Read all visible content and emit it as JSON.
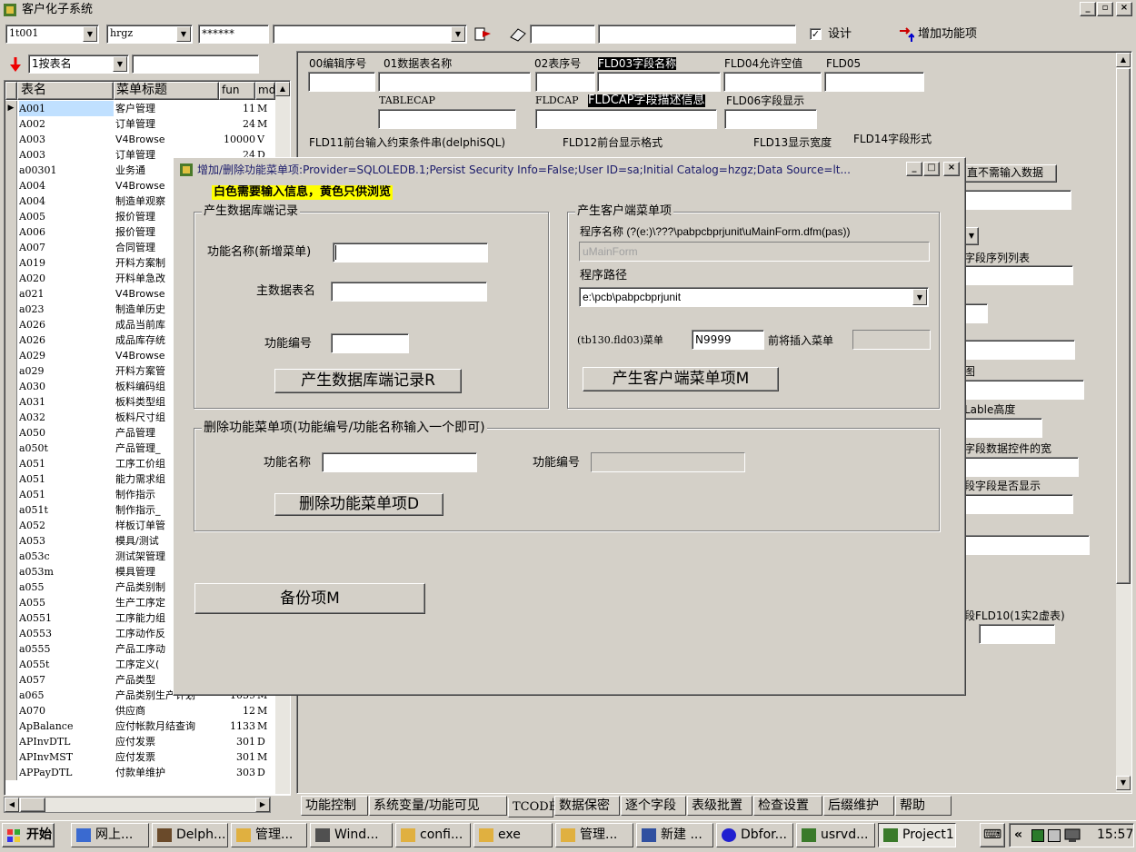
{
  "app": {
    "title": "客户化子系统"
  },
  "toolbar": {
    "combo1": "1t001",
    "combo2": "hrgz",
    "password": "******",
    "combo3": "",
    "field1": "",
    "field2": "",
    "check_label": "设计",
    "add_label": "增加功能项"
  },
  "left": {
    "sort_combo": "1按表名",
    "search": "",
    "headers": [
      "表名",
      "菜单标题",
      "fun",
      "md"
    ],
    "rows": [
      [
        "A001",
        "客户管理",
        "11",
        "M"
      ],
      [
        "A002",
        "订单管理",
        "24",
        "M"
      ],
      [
        "A003",
        "V4Browse",
        "10000",
        "V"
      ],
      [
        "A003",
        "订单管理",
        "24",
        "D"
      ],
      [
        "a00301",
        "业务通",
        "",
        ""
      ],
      [
        "A004",
        "V4Browse",
        "",
        ""
      ],
      [
        "A004",
        "制造单观察",
        "",
        ""
      ],
      [
        "A005",
        "报价管理",
        "",
        ""
      ],
      [
        "A006",
        "报价管理",
        "",
        ""
      ],
      [
        "A007",
        "合同管理",
        "",
        ""
      ],
      [
        "A019",
        "开料方案制",
        "",
        ""
      ],
      [
        "A020",
        "开料单急改",
        "",
        ""
      ],
      [
        "a021",
        "V4Browse",
        "",
        ""
      ],
      [
        "a023",
        "制造单历史",
        "",
        ""
      ],
      [
        "A026",
        "成品当前库",
        "",
        ""
      ],
      [
        "A026",
        "成品库存统",
        "",
        ""
      ],
      [
        "A029",
        "V4Browse",
        "",
        ""
      ],
      [
        "a029",
        "开料方案管",
        "",
        ""
      ],
      [
        "A030",
        "板料编码组",
        "",
        ""
      ],
      [
        "A031",
        "板料类型组",
        "",
        ""
      ],
      [
        "A032",
        "板料尺寸组",
        "",
        ""
      ],
      [
        "A050",
        "产品管理",
        "",
        ""
      ],
      [
        "a050t",
        "产品管理_",
        "",
        ""
      ],
      [
        "A051",
        "工序工价组",
        "",
        ""
      ],
      [
        "A051",
        "能力需求组",
        "",
        ""
      ],
      [
        "A051",
        "制作指示",
        "",
        ""
      ],
      [
        "a051t",
        "制作指示_",
        "",
        ""
      ],
      [
        "A052",
        "样板订单管",
        "",
        ""
      ],
      [
        "A053",
        "模具/测试",
        "",
        ""
      ],
      [
        "a053c",
        "测试架管理",
        "",
        ""
      ],
      [
        "a053m",
        "模具管理",
        "",
        ""
      ],
      [
        "a055",
        "产品类别制",
        "",
        ""
      ],
      [
        "A055",
        "生产工序定",
        "",
        ""
      ],
      [
        "A0551",
        "工序能力组",
        "",
        ""
      ],
      [
        "A0553",
        "工序动作反",
        "",
        ""
      ],
      [
        "a0555",
        "产品工序动",
        "",
        ""
      ],
      [
        "A055t",
        "工序定义(",
        "",
        ""
      ],
      [
        "A057",
        "产品类型",
        "",
        ""
      ],
      [
        "a065",
        "产品类别生产计划",
        "1059",
        "M"
      ],
      [
        "A070",
        "供应商",
        "12",
        "M"
      ],
      [
        "ApBalance",
        "应付帐款月结查询",
        "1133",
        "M"
      ],
      [
        "APInvDTL",
        "应付发票",
        "301",
        "D"
      ],
      [
        "APInvMST",
        "应付发票",
        "301",
        "M"
      ],
      [
        "APPayDTL",
        "付款单维护",
        "303",
        "D"
      ]
    ]
  },
  "right": {
    "f00": "00编辑序号",
    "f01": "01数据表名称",
    "f02": "02表序号",
    "f03": "FLD03字段名称",
    "f04": "FLD04允许空值",
    "f05": "FLD05",
    "tablecap": "TABLECAP",
    "fldcap": "FLDCAP",
    "fldcap2": "FLDCAP字段描述信息",
    "f06": "FLD06字段显示",
    "f11": "FLD11前台输入约束条件串(delphiSQL)",
    "f12": "FLD12前台显示格式",
    "f13": "FLD13显示宽度",
    "f14": "FLD14字段形式",
    "no_input": "直不需输入数据",
    "seq_list": "字段序列列表",
    "pic": "图",
    "lable_h": "Lable高度",
    "ctrl_w": "字段数据控件的宽",
    "show": "段字段是否显示",
    "fld10": "段FLD10(1实2虚表)"
  },
  "dialog": {
    "title": "增加/删除功能菜单项:Provider=SQLOLEDB.1;Persist Security Info=False;User ID=sa;Initial Catalog=hzgz;Data Source=lt...",
    "notice": "白色需要输入信息，黄色只供浏览",
    "g1_title": "产生数据库端记录",
    "func_name_label": "功能名称(新增菜单)",
    "func_name": "",
    "main_table_label": "主数据表名",
    "main_table": "",
    "func_no_label": "功能编号",
    "func_no": "",
    "gen_db_btn": "产生数据库端记录R",
    "g2_title": "产生客户端菜单项",
    "prog_name_label": "程序名称 (?(e:)\\???\\pabpcbprjunit\\uMainForm.dfm(pas))",
    "prog_name": "uMainForm",
    "prog_path_label": "程序路径",
    "prog_path": "e:\\pcb\\pabpcbprjunit",
    "menu_label": "(tb130.fld03)菜单",
    "menu_value": "N9999",
    "insert_label": "前将插入菜单",
    "insert_value": "",
    "gen_client_btn": "产生客户端菜单项M",
    "g3_title": "删除功能菜单项(功能编号/功能名称输入一个即可)",
    "del_name_label": "功能名称",
    "del_name": "",
    "del_no_label": "功能编号",
    "del_no": "",
    "del_btn": "删除功能菜单项D",
    "backup_btn": "备份项M"
  },
  "tabs": [
    "功能控制",
    "系统变量/功能可见",
    "TCODE",
    "数据保密",
    "逐个字段",
    "表级批置",
    "检查设置",
    "后缀维护",
    "帮助"
  ],
  "taskbar": {
    "start": "开始",
    "items": [
      "网上...",
      "Delph...",
      "管理...",
      "Wind...",
      "confi...",
      "exe",
      "管理...",
      "新建 ...",
      "Dbfor...",
      "usrvd...",
      "Project1"
    ],
    "chev": "«",
    "clock": "15:57"
  },
  "colors": {
    "title_bg": "#d4d0c8",
    "dialog_title": "#0a246a",
    "notice_bg": "#ffff00",
    "select": "#c0e0ff"
  }
}
